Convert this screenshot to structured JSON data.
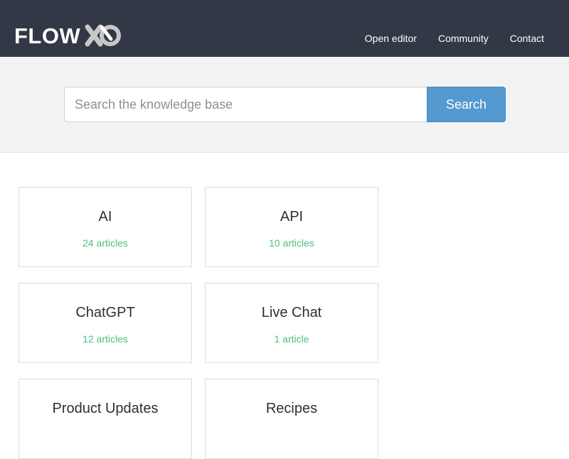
{
  "header": {
    "logo_text": "FLOW",
    "logo_mark_icon": "flow-x-circle-logo",
    "nav": [
      "Open editor",
      "Community",
      "Contact"
    ]
  },
  "search": {
    "placeholder": "Search the knowledge base",
    "button_label": "Search"
  },
  "categories": [
    {
      "title": "AI",
      "count": "24 articles"
    },
    {
      "title": "API",
      "count": "10 articles"
    },
    {
      "title": "ChatGPT",
      "count": "12 articles"
    },
    {
      "title": "Live Chat",
      "count": "1 article"
    },
    {
      "title": "Product Updates",
      "count": ""
    },
    {
      "title": "Recipes",
      "count": ""
    }
  ],
  "colors": {
    "header_background": "#323846",
    "search_button": "#5499d0",
    "article_count": "#4cbf7f",
    "page_band": "#f3f3f3"
  }
}
